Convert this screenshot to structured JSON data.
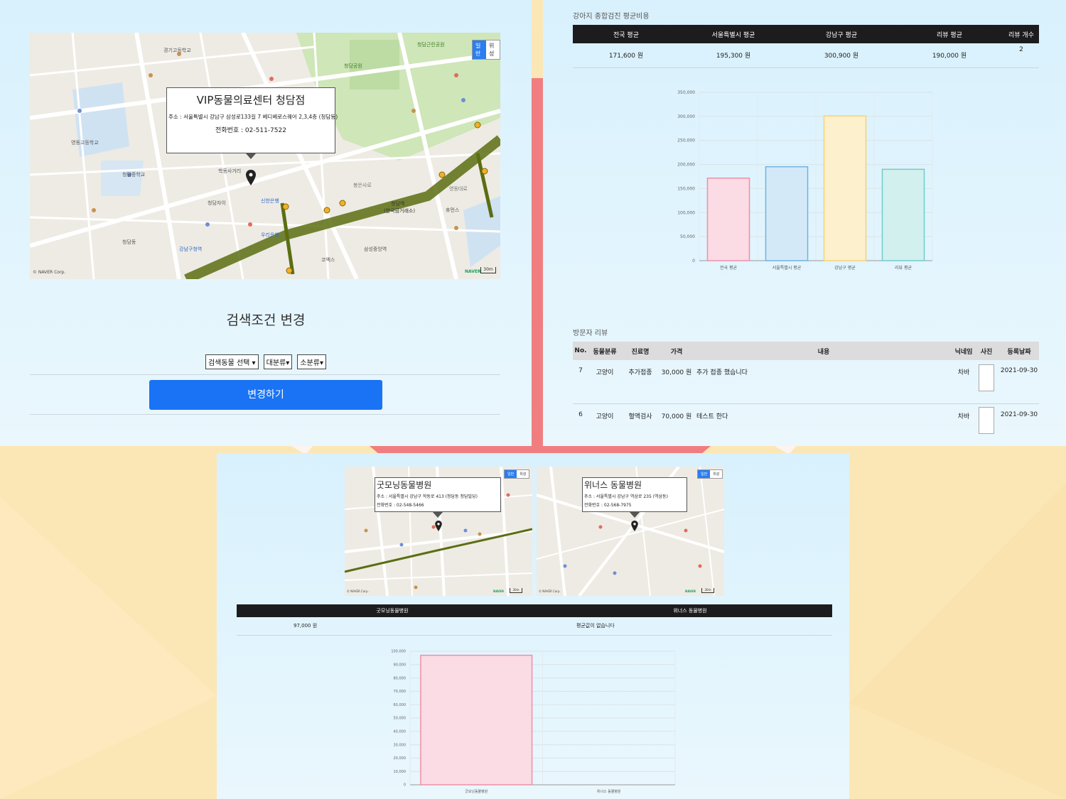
{
  "panel1": {
    "map": {
      "toggle": [
        "일반",
        "위성"
      ],
      "toggle_active": 0,
      "copyright": "© NAVER Corp.",
      "naver": "NAVER",
      "scale": "30m",
      "info": {
        "name": "VIP동물의료센터 청담점",
        "address": "주소 : 서울특별시 강남구 삼성로133길 7 베디베로스퀘어 2,3,4층 (청담동)",
        "phone": "전화번호 : 02-511-7522"
      },
      "labels": [
        "청담공원",
        "청담역",
        "(한국금거래소)",
        "학동사거리",
        "영동고등학교",
        "청담중학교",
        "신한은행",
        "우리은행",
        "청담근린공원",
        "경기고등학교",
        "삼성중앙역",
        "봉은사로",
        "청담동",
        "강남구청역",
        "코엑스",
        "휴먼스",
        "청담자이",
        "영동대로"
      ]
    },
    "title": "검색조건 변경",
    "selects": [
      "검색동물 선택",
      "대분류",
      "소분류"
    ],
    "button": "변경하기"
  },
  "panel2": {
    "section_title": "강아지 종합검진 평균비용",
    "table": {
      "headers": [
        "전국 평균",
        "서울특별시 평균",
        "강남구 평균",
        "리뷰 평균",
        "리뷰 개수"
      ],
      "row": [
        "171,600 원",
        "195,300 원",
        "300,900 원",
        "190,000 원",
        "2"
      ]
    },
    "review_title": "방문자 리뷰",
    "review_headers": [
      "No.",
      "동물분류",
      "진료명",
      "가격",
      "내용",
      "닉네임",
      "사진",
      "등록날짜"
    ],
    "reviews": [
      {
        "no": "7",
        "animal": "고양이",
        "treatment": "추가접종",
        "price": "30,000 원",
        "content": "추가 접종 했습니다",
        "nick": "차바",
        "date": "2021-09-30"
      },
      {
        "no": "6",
        "animal": "고양이",
        "treatment": "혈액검사",
        "price": "70,000 원",
        "content": "테스트 한다",
        "nick": "차바",
        "date": "2021-09-30"
      }
    ]
  },
  "panel3": {
    "map1": {
      "toggle": [
        "일반",
        "위성"
      ],
      "toggle_active": 0,
      "copyright": "© NAVER Corp.",
      "naver": "NAVER",
      "scale": "30m",
      "info": {
        "name": "굿모닝동물병원",
        "address": "주소 : 서울특별시 강남구 학동로 413 (청담동 청담빌딩)",
        "phone": "전화번호 : 02-548-5466"
      }
    },
    "map2": {
      "toggle": [
        "일반",
        "위성"
      ],
      "toggle_active": 0,
      "copyright": "© NAVER Corp.",
      "naver": "NAVER",
      "scale": "30m",
      "info": {
        "name": "위너스 동물병원",
        "address": "주소 : 서울특별시 강남구 역삼로 235 (역삼동)",
        "phone": "전화번호 : 02-568-7975"
      }
    },
    "table": {
      "headers": [
        "굿모닝동물병원",
        "위너스 동물병원"
      ],
      "row": [
        "97,000 원",
        "평균값이 없습니다"
      ]
    }
  },
  "chart_data": [
    {
      "type": "bar",
      "categories": [
        "전국 평균",
        "서울특별시 평균",
        "강남구 평균",
        "리뷰 평균"
      ],
      "values": [
        171600,
        195300,
        300900,
        190000
      ],
      "ylim": [
        0,
        350000
      ],
      "yticks": [
        0,
        50000,
        100000,
        150000,
        200000,
        250000,
        300000,
        350000
      ],
      "ytick_labels": [
        "0",
        "50,000",
        "100,000",
        "150,000",
        "200,000",
        "250,000",
        "300,000",
        "350,000"
      ],
      "colors": [
        {
          "fill": "#fbdbe4",
          "stroke": "#ef8fa8"
        },
        {
          "fill": "#d4e9f8",
          "stroke": "#6fb3e0"
        },
        {
          "fill": "#fdf0cc",
          "stroke": "#f5d27a"
        },
        {
          "fill": "#d2f0ee",
          "stroke": "#6fcdc9"
        }
      ],
      "grid": true
    },
    {
      "type": "bar",
      "categories": [
        "굿모닝동물병원",
        "위너스 동물병원"
      ],
      "values": [
        97000,
        null
      ],
      "ylim": [
        0,
        100000
      ],
      "yticks": [
        0,
        10000,
        20000,
        30000,
        40000,
        50000,
        60000,
        70000,
        80000,
        90000,
        100000
      ],
      "ytick_labels": [
        "0",
        "10,000",
        "20,000",
        "30,000",
        "40,000",
        "50,000",
        "60,000",
        "70,000",
        "80,000",
        "90,000",
        "100,000"
      ],
      "colors": [
        {
          "fill": "#fbdbe4",
          "stroke": "#ef8fa8"
        }
      ],
      "grid": true
    }
  ]
}
